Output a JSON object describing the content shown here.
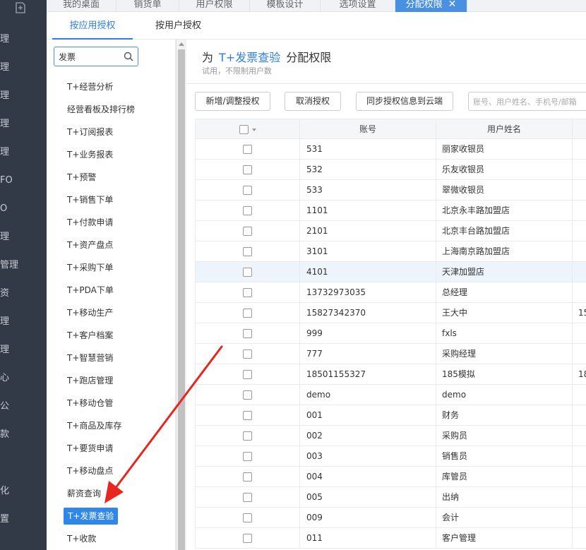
{
  "left_nav": {
    "items": [
      "理",
      "理",
      "理",
      "理",
      "理",
      "FO",
      "O",
      "理",
      "管理",
      "资",
      "理",
      "理",
      "心",
      "公",
      "款",
      "",
      "化",
      "置"
    ]
  },
  "top_tabs": {
    "items": [
      "我的桌面",
      "销货单",
      "用户权限",
      "模板设计",
      "选项设置"
    ],
    "active": "分配权限"
  },
  "sub_tabs": {
    "by_app": "按应用授权",
    "by_user": "按用户授权"
  },
  "app_panel": {
    "search_value": "发票",
    "items": [
      "T+经营分析",
      "经营看板及排行榜",
      "T+订阅报表",
      "T+业务报表",
      "T+预警",
      "T+销售下单",
      "T+付款申请",
      "T+资产盘点",
      "T+采购下单",
      "T+PDA下单",
      "T+移动生产",
      "T+客户档案",
      "T+智慧营销",
      "T+跑店管理",
      "T+移动仓管",
      "T+商品及库存",
      "T+要货申请",
      "T+移动盘点",
      "薪资查询",
      "T+发票查验",
      "T+收款"
    ],
    "selected_index": 19
  },
  "header": {
    "prefix": "为",
    "app_name": "T+发票查验",
    "suffix": "分配权限",
    "note": "试用，不限制用户数"
  },
  "toolbar": {
    "add_label": "新增/调整授权",
    "cancel_label": "取消授权",
    "sync_label": "同步授权信息到云端",
    "filter_placeholder": "账号、用户姓名、手机号/邮箱"
  },
  "table": {
    "columns": [
      "账号",
      "用户姓名"
    ],
    "rows": [
      {
        "account": "531",
        "name": "丽家收银员",
        "extra": ""
      },
      {
        "account": "532",
        "name": "乐友收银员",
        "extra": ""
      },
      {
        "account": "533",
        "name": "翠微收银员",
        "extra": ""
      },
      {
        "account": "1101",
        "name": "北京永丰路加盟店",
        "extra": ""
      },
      {
        "account": "2101",
        "name": "北京丰台路加盟店",
        "extra": ""
      },
      {
        "account": "3101",
        "name": "上海南京路加盟店",
        "extra": ""
      },
      {
        "account": "4101",
        "name": "天津加盟店",
        "extra": ""
      },
      {
        "account": "13732973035",
        "name": "总经理",
        "extra": ""
      },
      {
        "account": "15827342370",
        "name": "王大中",
        "extra": "15"
      },
      {
        "account": "999",
        "name": "fxls",
        "extra": ""
      },
      {
        "account": "777",
        "name": "采购经理",
        "extra": ""
      },
      {
        "account": "18501155327",
        "name": "185模拟",
        "extra": "18"
      },
      {
        "account": "demo",
        "name": "demo",
        "extra": ""
      },
      {
        "account": "001",
        "name": "财务",
        "extra": ""
      },
      {
        "account": "002",
        "name": "采购员",
        "extra": ""
      },
      {
        "account": "003",
        "name": "销售员",
        "extra": ""
      },
      {
        "account": "004",
        "name": "库管员",
        "extra": ""
      },
      {
        "account": "005",
        "name": "出纳",
        "extra": ""
      },
      {
        "account": "009",
        "name": "会计",
        "extra": ""
      },
      {
        "account": "011",
        "name": "客户管理",
        "extra": ""
      }
    ],
    "hover_index": 6
  },
  "colors": {
    "accent": "#2f7fe0",
    "nav_bg": "#333a47",
    "annotation": "#e8251e"
  }
}
